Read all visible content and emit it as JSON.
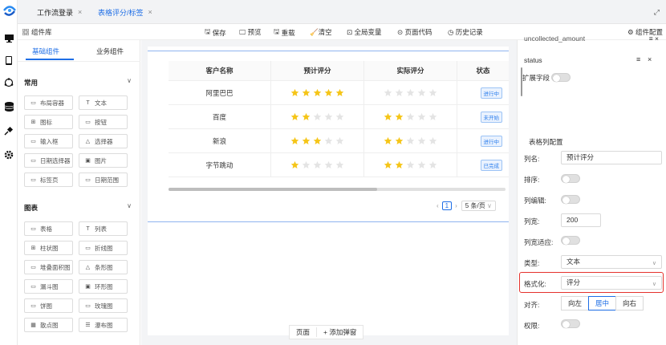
{
  "tabs": [
    {
      "label": "工作流登录",
      "active": false
    },
    {
      "label": "表格评分/标签",
      "active": true
    }
  ],
  "tab_close": "×",
  "toolbar": {
    "component_lib": "组件库",
    "save": "保存",
    "preview": "预览",
    "redo": "重载",
    "clear": "清空",
    "global_vars": "全局变量",
    "page_code": "页面代码",
    "history": "历史记录",
    "component_config": "组件配置"
  },
  "comp_tabs": {
    "basic": "基础组件",
    "business": "业务组件"
  },
  "sections": {
    "common": "常用",
    "charts": "图表"
  },
  "common_items": [
    "布局容器",
    "文本",
    "图标",
    "按钮",
    "输入框",
    "选择器",
    "日期选择器",
    "图片",
    "标签页",
    "日期范围"
  ],
  "chart_items": [
    "表格",
    "列表",
    "柱状图",
    "折线图",
    "堆叠面积图",
    "条形图",
    "漏斗图",
    "环形图",
    "饼图",
    "玫瑰图",
    "散点图",
    "瀑布图"
  ],
  "table": {
    "headers": [
      "客户名称",
      "预计评分",
      "实际评分",
      "状态"
    ],
    "rows": [
      {
        "name": "阿里巴巴",
        "expected": 5,
        "actual": 0,
        "status": "进行中"
      },
      {
        "name": "百度",
        "expected": 2,
        "actual": 2,
        "status": "未开始"
      },
      {
        "name": "新浪",
        "expected": 3,
        "actual": 2,
        "status": "进行中"
      },
      {
        "name": "字节跳动",
        "expected": 1,
        "actual": 2,
        "status": "已完成"
      }
    ],
    "max_stars": 5,
    "colors": {
      "star_on": "#f5c518",
      "star_off": "#e4e4e4"
    }
  },
  "pagination": {
    "page": "1",
    "page_size": "5 条/页"
  },
  "bottom": {
    "page_tab": "页面",
    "add_popup": "+ 添加弹窗"
  },
  "right": {
    "field_top": "uncollected_amount",
    "status_field": "status",
    "ext_field": "扩展字段",
    "section_title": "表格列配置",
    "col_name_label": "列名:",
    "col_name": "预计评分",
    "sort_label": "排序:",
    "edit_label": "列编辑:",
    "width_label": "列宽:",
    "width": "200",
    "adapt_label": "列宽适应:",
    "type_label": "类型:",
    "type": "文本",
    "format_label": "格式化:",
    "format": "评分",
    "align_label": "对齐:",
    "align_left": "向左",
    "align_center": "居中",
    "align_right": "向右",
    "perm_label": "权限:"
  },
  "accent": "#1e6ee6",
  "highlight": "#e5322d"
}
